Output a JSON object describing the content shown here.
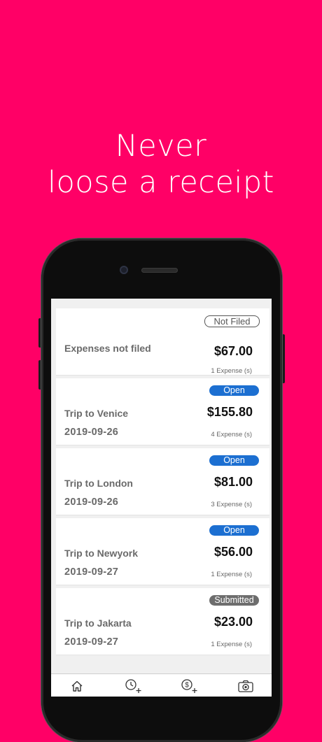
{
  "headline": {
    "line1": "Never",
    "line2": "loose a receipt"
  },
  "not_filed": {
    "badge": "Not Filed",
    "title": "Expenses not filed",
    "amount": "$67.00",
    "count": "1  Expense (s)"
  },
  "trips": [
    {
      "name": "Trip to Venice",
      "date": "2019-09-26",
      "status": "Open",
      "amount": "$155.80",
      "count": "4  Expense (s)"
    },
    {
      "name": "Trip to London",
      "date": "2019-09-26",
      "status": "Open",
      "amount": "$81.00",
      "count": "3  Expense (s)"
    },
    {
      "name": "Trip to Newyork",
      "date": "2019-09-27",
      "status": "Open",
      "amount": "$56.00",
      "count": "1  Expense (s)"
    },
    {
      "name": "Trip to Jakarta",
      "date": "2019-09-27",
      "status": "Submitted",
      "amount": "$23.00",
      "count": "1  Expense (s)"
    }
  ],
  "tabs": [
    {
      "icon": "home-icon"
    },
    {
      "icon": "clock-add-icon"
    },
    {
      "icon": "dollar-add-icon"
    },
    {
      "icon": "camera-icon"
    }
  ],
  "colors": {
    "background": "#ff0066",
    "open_badge": "#1c6fd1",
    "submitted_badge": "#6d6d6d"
  }
}
